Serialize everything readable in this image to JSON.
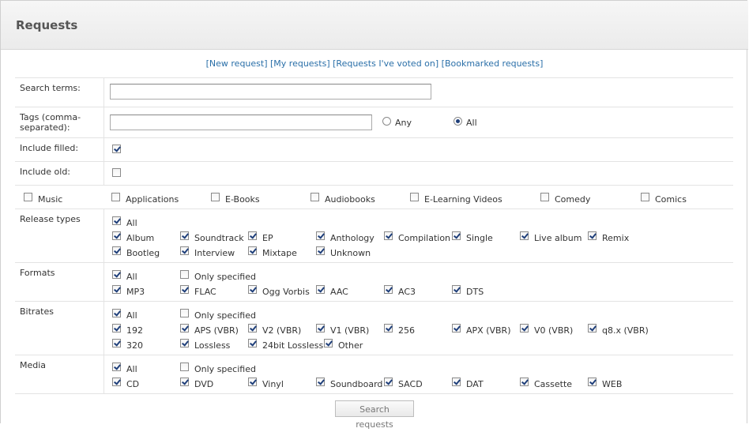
{
  "header": {
    "title": "Requests"
  },
  "links": [
    {
      "label": "[New request]"
    },
    {
      "label": "[My requests]"
    },
    {
      "label": "[Requests I've voted on]"
    },
    {
      "label": "[Bookmarked requests]"
    }
  ],
  "search": {
    "label": "Search terms:",
    "value": ""
  },
  "tags": {
    "label": "Tags (comma-separated):",
    "label_line1": "Tags (comma-",
    "label_line2": "separated):",
    "value": "",
    "any_label": "Any",
    "all_label": "All",
    "selected": "All"
  },
  "include_filled": {
    "label": "Include filled:",
    "checked": true
  },
  "include_old": {
    "label": "Include old:",
    "checked": false
  },
  "categories": [
    {
      "label": "Music",
      "checked": false
    },
    {
      "label": "Applications",
      "checked": false
    },
    {
      "label": "E-Books",
      "checked": false
    },
    {
      "label": "Audiobooks",
      "checked": false
    },
    {
      "label": "E-Learning Videos",
      "checked": false
    },
    {
      "label": "Comedy",
      "checked": false
    },
    {
      "label": "Comics",
      "checked": false
    }
  ],
  "release_types": {
    "label": "Release types",
    "all_label": "All",
    "items": [
      {
        "label": "Album",
        "checked": true
      },
      {
        "label": "Soundtrack",
        "checked": true
      },
      {
        "label": "EP",
        "checked": true
      },
      {
        "label": "Anthology",
        "checked": true
      },
      {
        "label": "Compilation",
        "checked": true
      },
      {
        "label": "Single",
        "checked": true
      },
      {
        "label": "Live album",
        "checked": true
      },
      {
        "label": "Remix",
        "checked": true
      },
      {
        "label": "Bootleg",
        "checked": true
      },
      {
        "label": "Interview",
        "checked": true
      },
      {
        "label": "Mixtape",
        "checked": true
      },
      {
        "label": "Unknown",
        "checked": true
      }
    ]
  },
  "formats": {
    "label": "Formats",
    "all_label": "All",
    "only_label": "Only specified",
    "items": [
      {
        "label": "MP3",
        "checked": true
      },
      {
        "label": "FLAC",
        "checked": true
      },
      {
        "label": "Ogg Vorbis",
        "checked": true
      },
      {
        "label": "AAC",
        "checked": true
      },
      {
        "label": "AC3",
        "checked": true
      },
      {
        "label": "DTS",
        "checked": true
      }
    ]
  },
  "bitrates": {
    "label": "Bitrates",
    "all_label": "All",
    "only_label": "Only specified",
    "items": [
      {
        "label": "192",
        "checked": true
      },
      {
        "label": "APS (VBR)",
        "checked": true
      },
      {
        "label": "V2 (VBR)",
        "checked": true
      },
      {
        "label": "V1 (VBR)",
        "checked": true
      },
      {
        "label": "256",
        "checked": true
      },
      {
        "label": "APX (VBR)",
        "checked": true
      },
      {
        "label": "V0 (VBR)",
        "checked": true
      },
      {
        "label": "q8.x (VBR)",
        "checked": true
      },
      {
        "label": "320",
        "checked": true
      },
      {
        "label": "Lossless",
        "checked": true
      },
      {
        "label": "24bit Lossless",
        "checked": true
      },
      {
        "label": "Other",
        "checked": true
      }
    ]
  },
  "media": {
    "label": "Media",
    "all_label": "All",
    "only_label": "Only specified",
    "items": [
      {
        "label": "CD",
        "checked": true
      },
      {
        "label": "DVD",
        "checked": true
      },
      {
        "label": "Vinyl",
        "checked": true
      },
      {
        "label": "Soundboard",
        "checked": true
      },
      {
        "label": "SACD",
        "checked": true
      },
      {
        "label": "DAT",
        "checked": true
      },
      {
        "label": "Cassette",
        "checked": true
      },
      {
        "label": "WEB",
        "checked": true
      }
    ]
  },
  "submit": {
    "label": "Search requests"
  }
}
